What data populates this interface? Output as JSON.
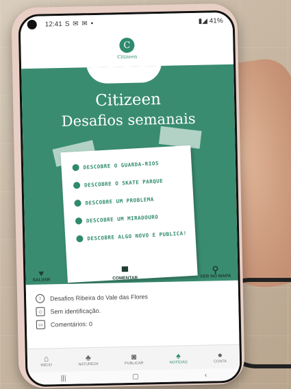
{
  "status_bar": {
    "time": "12:41",
    "left_icons": "S ✉ ✉ •",
    "battery": "41%"
  },
  "app": {
    "logo_letter": "C",
    "logo_text": "Citizeen"
  },
  "hero": {
    "title": "Citizeen",
    "subtitle": "Desafios semanais",
    "challenges": [
      {
        "label": "DESCOBRE O GUARDA-RIOS"
      },
      {
        "label": "DESCOBRE O SKATE PARQUE"
      },
      {
        "label": "DESCOBRE UM PROBLEMA"
      },
      {
        "label": "DESCOBRE UM MIRADOURO"
      },
      {
        "label": "DESCOBRE ALGO NOVO E PUBLICA!"
      }
    ]
  },
  "actions": {
    "save": "SALVAR",
    "comment": "COMENTAR",
    "map": "VER NO MAPA"
  },
  "info": {
    "title": "Desafios Ribeira do Vale das Flores",
    "identification": "Sem identificação.",
    "comments": "Comentários: 0"
  },
  "bottom_nav": [
    {
      "label": "INÍCIO",
      "icon": "home-icon"
    },
    {
      "label": "NATUREZA",
      "icon": "tree-icon"
    },
    {
      "label": "PUBLICAR",
      "icon": "camera-icon"
    },
    {
      "label": "NOTÍCIAS",
      "icon": "bell-icon"
    },
    {
      "label": "CONTA",
      "icon": "person-icon"
    }
  ],
  "colors": {
    "accent": "#3a8c70",
    "dark_text": "#1e3d33"
  }
}
